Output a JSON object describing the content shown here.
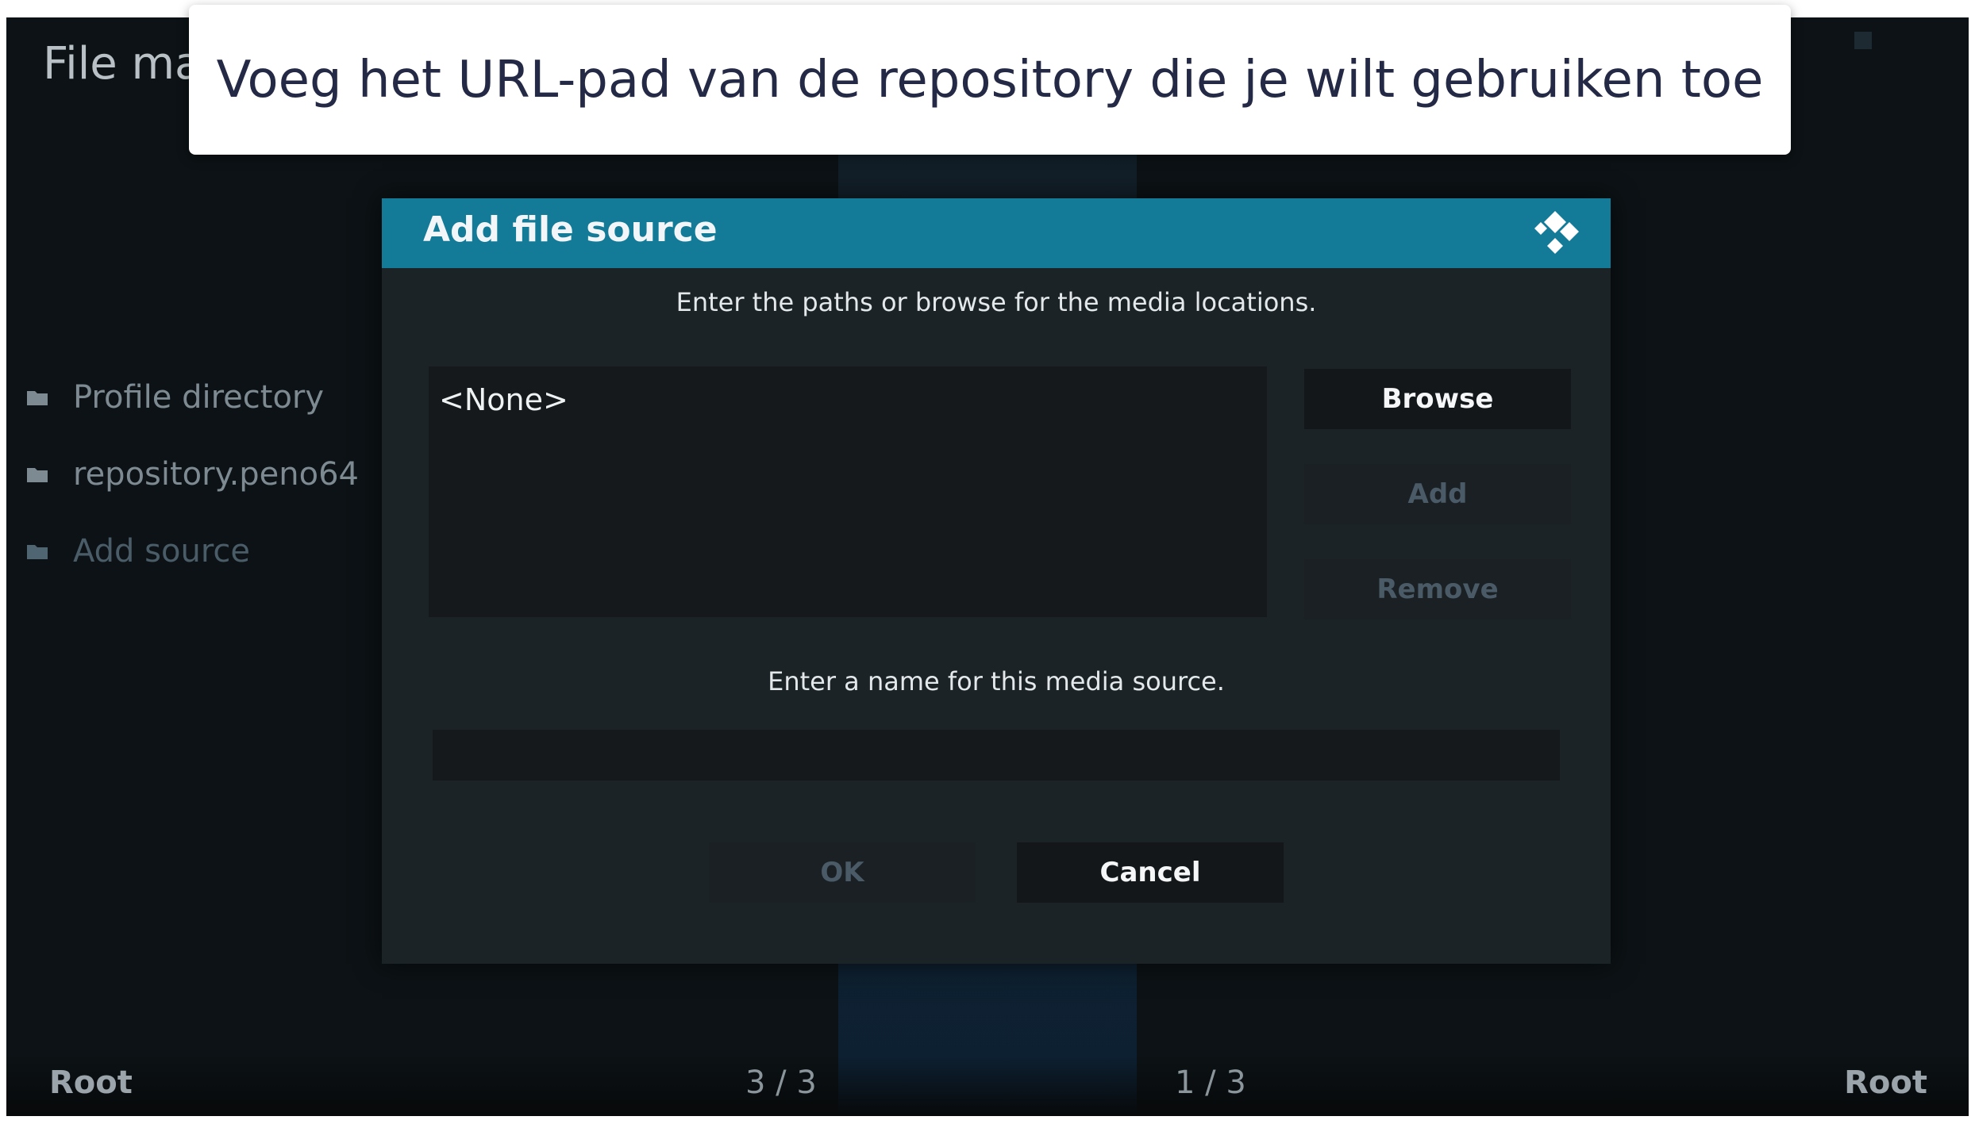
{
  "background": {
    "title": "File ma",
    "side_items": [
      {
        "label": "Profile directory"
      },
      {
        "label": "repository.peno64"
      },
      {
        "label": "Add source"
      }
    ],
    "footer": {
      "left": "Root",
      "count_left": "3 / 3",
      "count_right": "1 / 3",
      "right": "Root"
    }
  },
  "banner": {
    "text": "Voeg het URL-pad van de repository die je wilt gebruiken toe"
  },
  "dialog": {
    "title": "Add file source",
    "header_icon": "kodi-logo-icon",
    "paths_prompt": "Enter the paths or browse for the media locations.",
    "paths_list": [
      "<None>"
    ],
    "buttons": {
      "browse": "Browse",
      "add": "Add",
      "remove": "Remove",
      "ok": "OK",
      "cancel": "Cancel"
    },
    "name_prompt": "Enter a name for this media source.",
    "name_value": ""
  },
  "colors": {
    "header": "#137a97",
    "dialog_bg": "#1c2327",
    "button_bg": "#13171a",
    "disabled_text": "#4a5b67",
    "banner_text": "#242a45"
  }
}
